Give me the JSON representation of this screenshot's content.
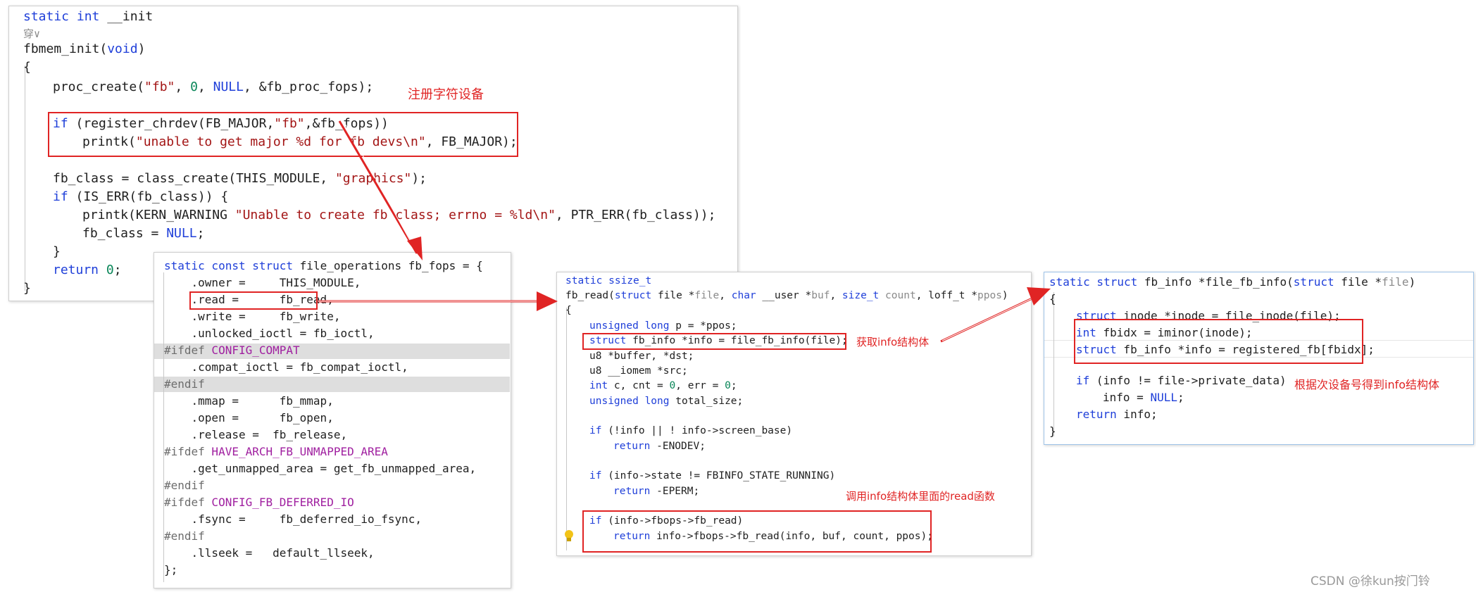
{
  "panel1": {
    "l1_kw": "static int",
    "l1_rest": " __init",
    "l2": "穿∨",
    "l3_fn": "fbmem_init(",
    "l3_kw": "void",
    "l3_end": ")",
    "l4": "{",
    "l5_a": "proc_create(",
    "l5_str": "\"fb\"",
    "l5_b": ", ",
    "l5_num": "0",
    "l5_c": ", ",
    "l5_null": "NULL",
    "l5_d": ", &fb_proc_fops);",
    "l6_kw": "if",
    "l6_a": " (register_chrdev(FB_MAJOR,",
    "l6_str": "\"fb\"",
    "l6_b": ",&fb_fops))",
    "l7_a": "printk(",
    "l7_str": "\"unable to get major %d for fb devs\\n\"",
    "l7_b": ", FB_MAJOR);",
    "l8_a": "fb_class = class_create(THIS_MODULE, ",
    "l8_str": "\"graphics\"",
    "l8_b": ");",
    "l9_kw": "if",
    "l9_a": " (IS_ERR(fb_class)) {",
    "l10_a": "printk(KERN_WARNING ",
    "l10_str": "\"Unable to create fb class; errno = %ld\\n\"",
    "l10_b": ", PTR_ERR(fb_class));",
    "l11_a": "fb_class = ",
    "l11_null": "NULL",
    "l11_b": ";",
    "l12": "}",
    "l13_kw": "return",
    "l13_sp": " ",
    "l13_num": "0",
    "l13_b": ";",
    "l14": "}",
    "annotation": "注册字符设备"
  },
  "panel2": {
    "l1_kw": "static const struct",
    "l1_rest": " file_operations fb_fops = {",
    "l2": "    .owner =     THIS_MODULE,",
    "l3": "    .read =      fb_read,",
    "l4": "    .write =     fb_write,",
    "l5": "    .unlocked_ioctl = fb_ioctl,",
    "l6_pp": "#ifdef",
    "l6_mac": " CONFIG_COMPAT",
    "l7": "    .compat_ioctl = fb_compat_ioctl,",
    "l8_pp": "#endif",
    "l9": "    .mmap =      fb_mmap,",
    "l10": "    .open =      fb_open,",
    "l11": "    .release =  fb_release,",
    "l12_pp": "#ifdef",
    "l12_mac": " HAVE_ARCH_FB_UNMAPPED_AREA",
    "l13": "    .get_unmapped_area = get_fb_unmapped_area,",
    "l14_pp": "#endif",
    "l15_pp": "#ifdef",
    "l15_mac": " CONFIG_FB_DEFERRED_IO",
    "l16": "    .fsync =     fb_deferred_io_fsync,",
    "l17_pp": "#endif",
    "l18": "    .llseek =   default_llseek,",
    "l19": "};"
  },
  "panel3": {
    "l1_kw": "static ssize_t",
    "l2_a": "fb_read(",
    "l2_kw1": "struct",
    "l2_b": " file *",
    "l2_g1": "file",
    "l2_c": ", ",
    "l2_kw2": "char",
    "l2_d": " __user *",
    "l2_g2": "buf",
    "l2_e": ", ",
    "l2_kw3": "size_t",
    "l2_g3": " count",
    "l2_f": ", loff_t *",
    "l2_g4": "ppos",
    "l2_end": ")",
    "l3": "{",
    "l4_kw": "unsigned long",
    "l4_rest": " p = *ppos;",
    "l5_kw": "struct",
    "l5_rest": " fb_info *info = file_fb_info(file);",
    "l6": "u8 *buffer, *dst;",
    "l7": "u8 __iomem *src;",
    "l8_kw": "int",
    "l8_a": " c, cnt = ",
    "l8_n1": "0",
    "l8_b": ", err = ",
    "l8_n2": "0",
    "l8_c": ";",
    "l9_kw": "unsigned long",
    "l9_rest": " total_size;",
    "l10_kw": "if",
    "l10_rest": " (!info || ! info->screen_base)",
    "l11_kw": "return",
    "l11_rest": " -ENODEV;",
    "l12_kw": "if",
    "l12_rest": " (info->state != FBINFO_STATE_RUNNING)",
    "l13_kw": "return",
    "l13_rest": " -EPERM;",
    "l14_kw": "if",
    "l14_rest": " (info->fbops->fb_read)",
    "l15_kw": "return",
    "l15_rest": " info->fbops->fb_read(info, buf, count, ppos);",
    "annotation1": "获取info结构体",
    "annotation2": "调用info结构体里面的read函数"
  },
  "panel4": {
    "l1_kw1": "static struct",
    "l1_a": " fb_info *file_fb_info(",
    "l1_kw2": "struct",
    "l1_b": " file *",
    "l1_g": "file",
    "l1_end": ")",
    "l2": "{",
    "l3_kw": "struct",
    "l3_rest": " inode *inode = file_inode(file);",
    "l4_kw": "int",
    "l4_rest": " fbidx = iminor(inode);",
    "l5_kw": "struct",
    "l5_rest": " fb_info *info = registered_fb[fbidx];",
    "l6_kw": "if",
    "l6_rest": " (info != file->private_data)",
    "l7_a": "info = ",
    "l7_null": "NULL",
    "l7_b": ";",
    "l8_kw": "return",
    "l8_rest": " info;",
    "l9": "}",
    "annotation": "根据次设备号得到info结构体"
  },
  "watermark": "CSDN @徐kun按门铃",
  "colors": {
    "keyword": "#1f3fd9",
    "string": "#a31515",
    "number": "#098658",
    "macro": "#a020a0",
    "annotation_red": "#e02424"
  }
}
